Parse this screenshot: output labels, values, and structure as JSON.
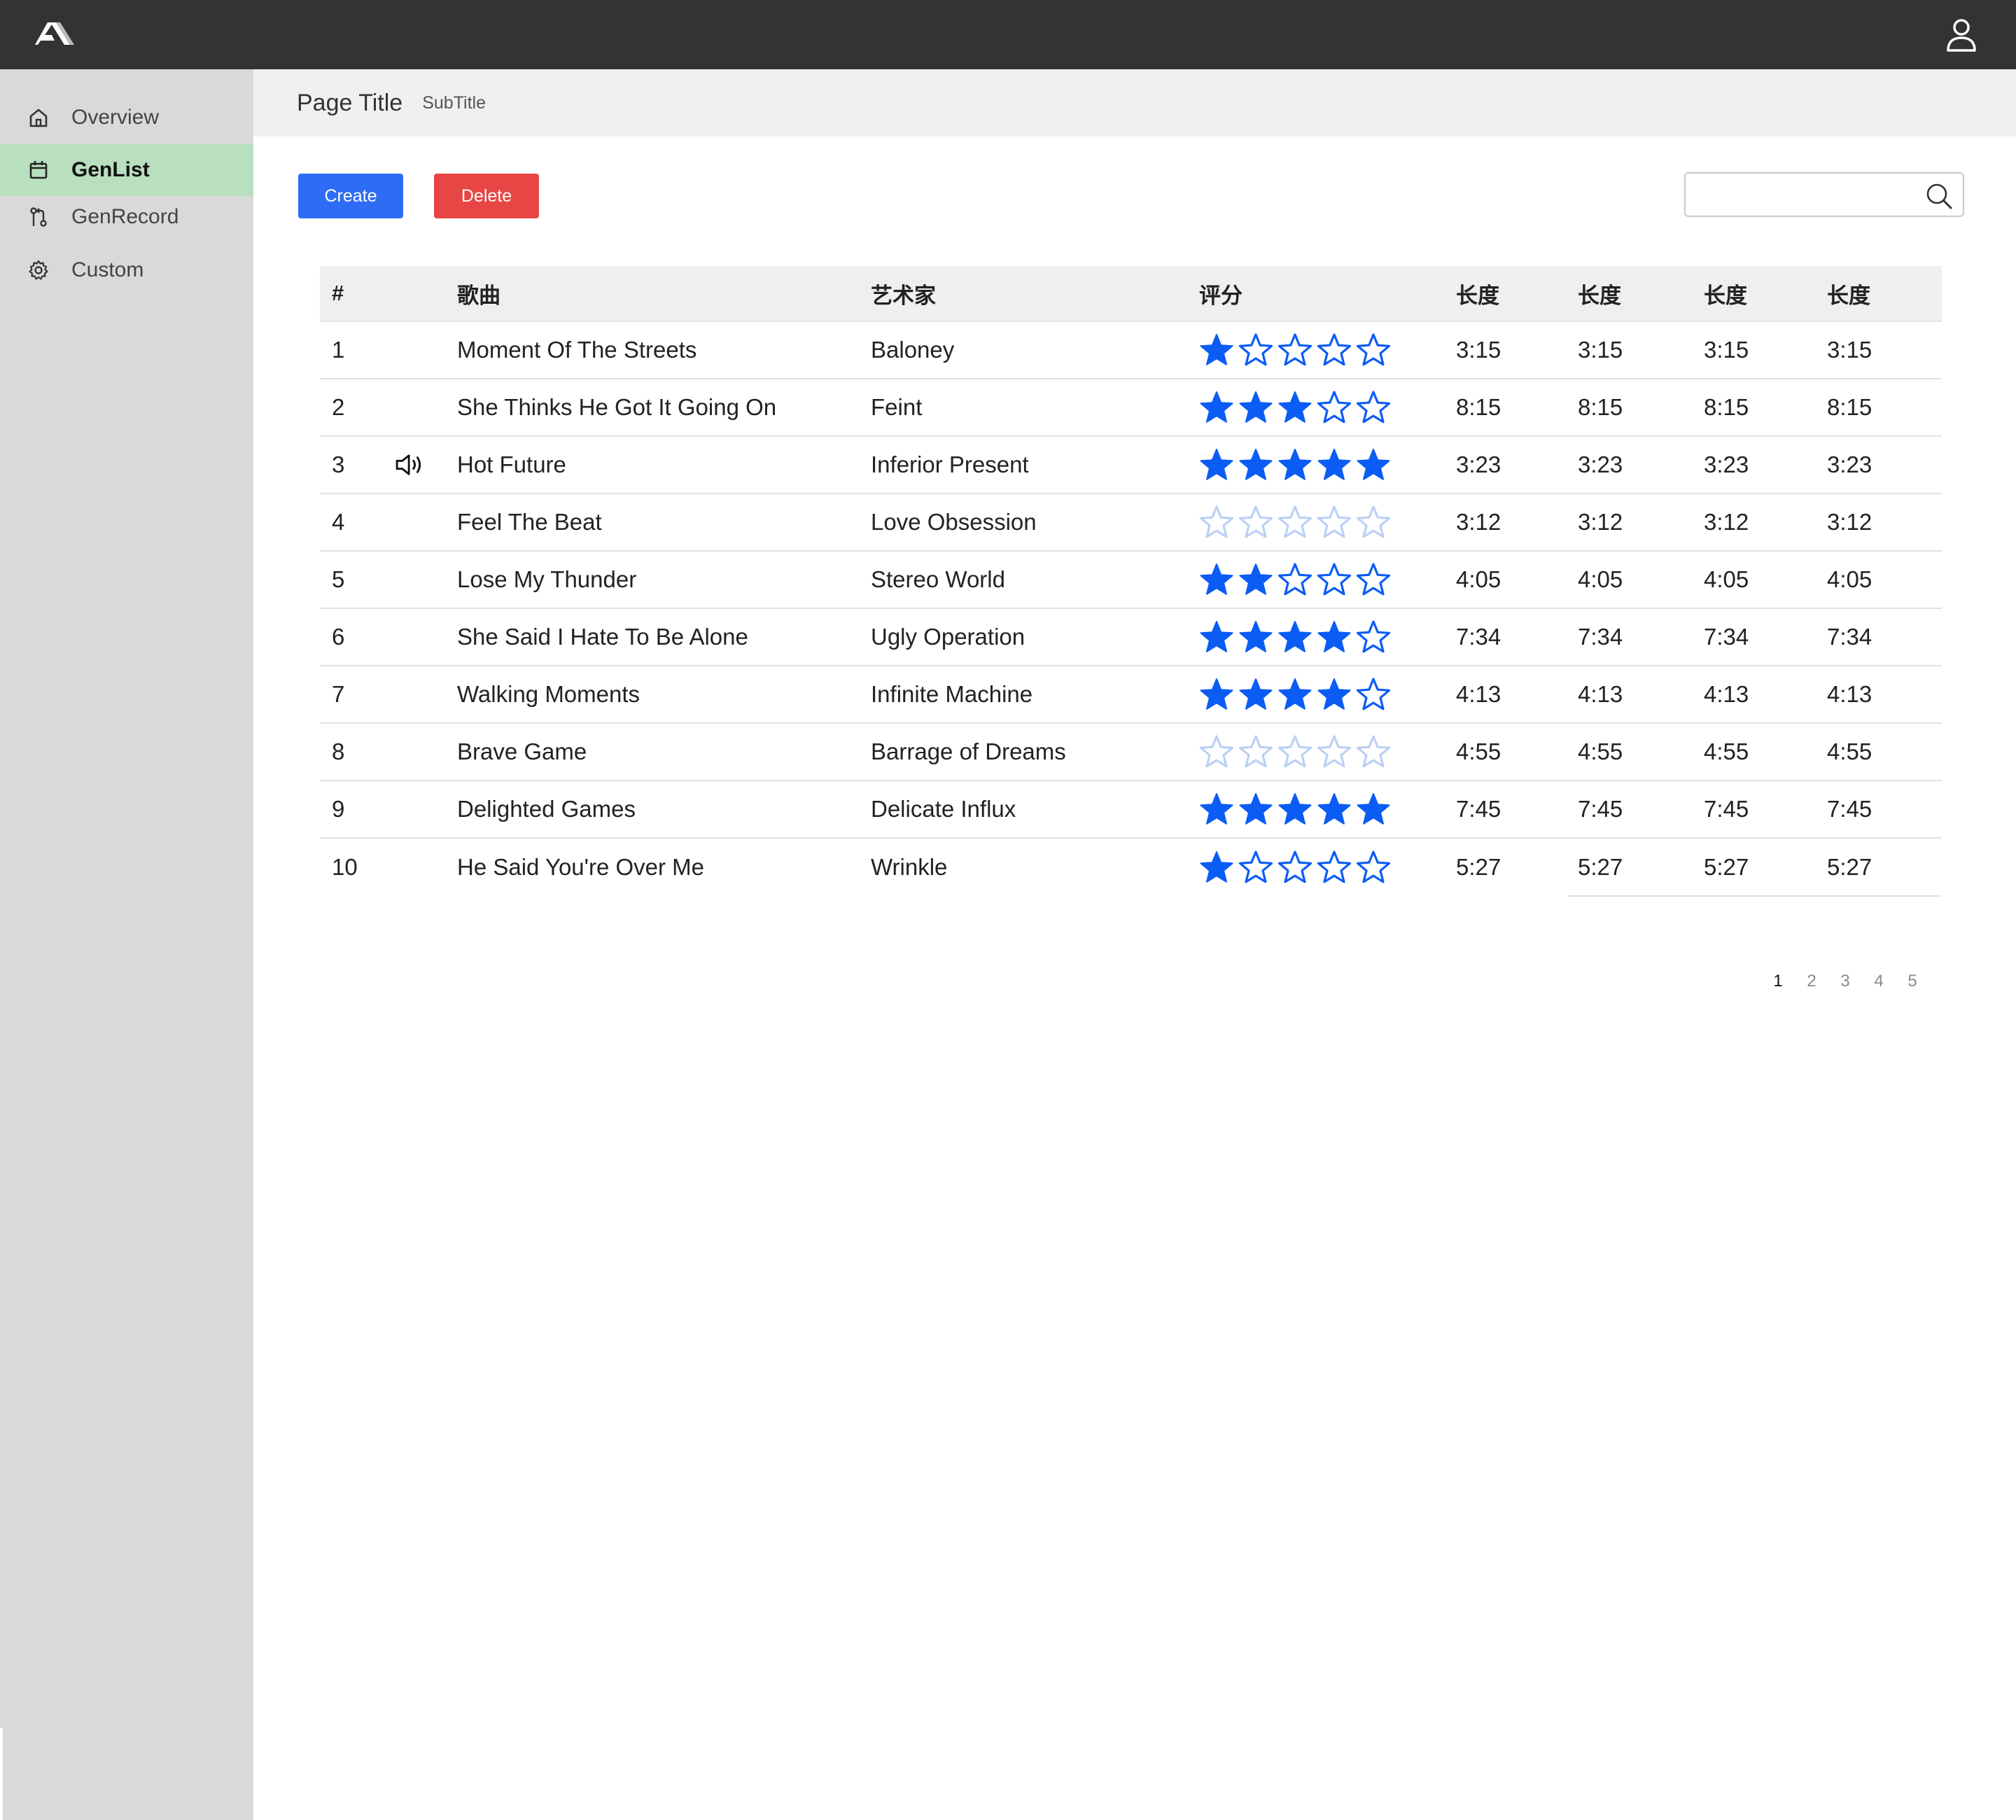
{
  "header": {
    "logo": "logo-mark",
    "user_icon": "user-icon"
  },
  "sidebar": {
    "items": [
      {
        "label": "Overview",
        "icon": "home-icon",
        "active": false
      },
      {
        "label": "GenList",
        "icon": "calendar-icon",
        "active": true
      },
      {
        "label": "GenRecord",
        "icon": "git-branch-icon",
        "active": false
      },
      {
        "label": "Custom",
        "icon": "gear-icon",
        "active": false
      }
    ]
  },
  "page": {
    "title": "Page Title",
    "subtitle": "SubTitle"
  },
  "toolbar": {
    "create_label": "Create",
    "delete_label": "Delete",
    "search_value": "",
    "search_placeholder": ""
  },
  "table": {
    "columns": [
      "#",
      "",
      "歌曲",
      "艺术家",
      "评分",
      "长度",
      "长度",
      "长度",
      "长度"
    ],
    "rows": [
      {
        "num": "1",
        "playing": false,
        "song": "Moment Of The Streets",
        "artist": "Baloney",
        "rating": 1,
        "length": "3:15"
      },
      {
        "num": "2",
        "playing": false,
        "song": "She Thinks He Got It Going On",
        "artist": "Feint",
        "rating": 3,
        "length": "8:15"
      },
      {
        "num": "3",
        "playing": true,
        "song": "Hot Future",
        "artist": "Inferior Present",
        "rating": 5,
        "length": "3:23"
      },
      {
        "num": "4",
        "playing": false,
        "song": "Feel The Beat",
        "artist": "Love Obsession",
        "rating": 0,
        "length": "3:12"
      },
      {
        "num": "5",
        "playing": false,
        "song": "Lose My Thunder",
        "artist": "Stereo World",
        "rating": 2,
        "length": "4:05"
      },
      {
        "num": "6",
        "playing": false,
        "song": "She Said I Hate To Be Alone",
        "artist": "Ugly Operation",
        "rating": 4,
        "length": "7:34"
      },
      {
        "num": "7",
        "playing": false,
        "song": "Walking Moments",
        "artist": "Infinite Machine",
        "rating": 4,
        "length": "4:13"
      },
      {
        "num": "8",
        "playing": false,
        "song": "Brave Game",
        "artist": "Barrage of Dreams",
        "rating": 0,
        "length": "4:55"
      },
      {
        "num": "9",
        "playing": false,
        "song": "Delighted Games",
        "artist": "Delicate Influx",
        "rating": 5,
        "length": "7:45"
      },
      {
        "num": "10",
        "playing": false,
        "song": "He Said You're Over Me",
        "artist": "Wrinkle",
        "rating": 1,
        "length": "5:27"
      }
    ],
    "rating_max": 5,
    "playing_icon": "speaker-icon"
  },
  "pagination": {
    "pages": [
      "1",
      "2",
      "3",
      "4",
      "5"
    ],
    "current": "1"
  },
  "colors": {
    "topbar": "#333333",
    "sidebar": "#d9d9d9",
    "active_nav": "#b8dfbe",
    "create": "#2f6cf5",
    "delete": "#e84545",
    "star_filled": "#0a5cf5",
    "star_empty_outline": "#0a5cf5",
    "star_unrated_outline": "#bcd0f5"
  }
}
